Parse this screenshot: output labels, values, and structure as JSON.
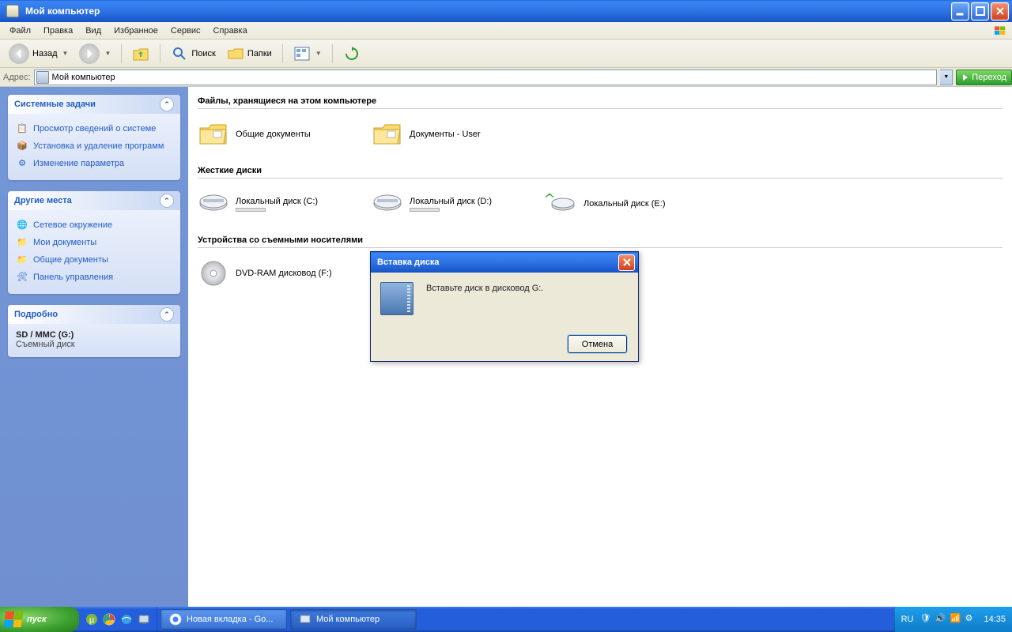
{
  "window": {
    "title": "Мой компьютер"
  },
  "menu": {
    "file": "Файл",
    "edit": "Правка",
    "view": "Вид",
    "favorites": "Избранное",
    "tools": "Сервис",
    "help": "Справка"
  },
  "toolbar": {
    "back": "Назад",
    "search": "Поиск",
    "folders": "Папки"
  },
  "address": {
    "label": "Адрес:",
    "value": "Мой компьютер",
    "go": "Переход"
  },
  "sidebar": {
    "tasks": {
      "title": "Системные задачи",
      "items": [
        "Просмотр сведений о системе",
        "Установка и удаление программ",
        "Изменение параметра"
      ]
    },
    "places": {
      "title": "Другие места",
      "items": [
        "Сетевое окружение",
        "Мои документы",
        "Общие документы",
        "Панель управления"
      ]
    },
    "details": {
      "title": "Подробно",
      "line1": "SD / MMC (G:)",
      "line2": "Съемный диск"
    }
  },
  "content": {
    "g1": {
      "title": "Файлы, хранящиеся на этом компьютере",
      "items": [
        "Общие документы",
        "Документы - User"
      ]
    },
    "g2": {
      "title": "Жесткие диски",
      "items": [
        "Локальный диск (C:)",
        "Локальный диск (D:)",
        "Локальный диск (E:)"
      ]
    },
    "g3": {
      "title": "Устройства со съемными носителями",
      "items": [
        "DVD-RAM дисковод (F:)"
      ]
    }
  },
  "dialog": {
    "title": "Вставка диска",
    "text": "Вставьте диск в дисковод G:.",
    "cancel": "Отмена"
  },
  "taskbar": {
    "start": "пуск",
    "task1": "Новая вкладка - Go...",
    "task2": "Мой компьютер",
    "lang": "RU",
    "clock": "14:35"
  }
}
